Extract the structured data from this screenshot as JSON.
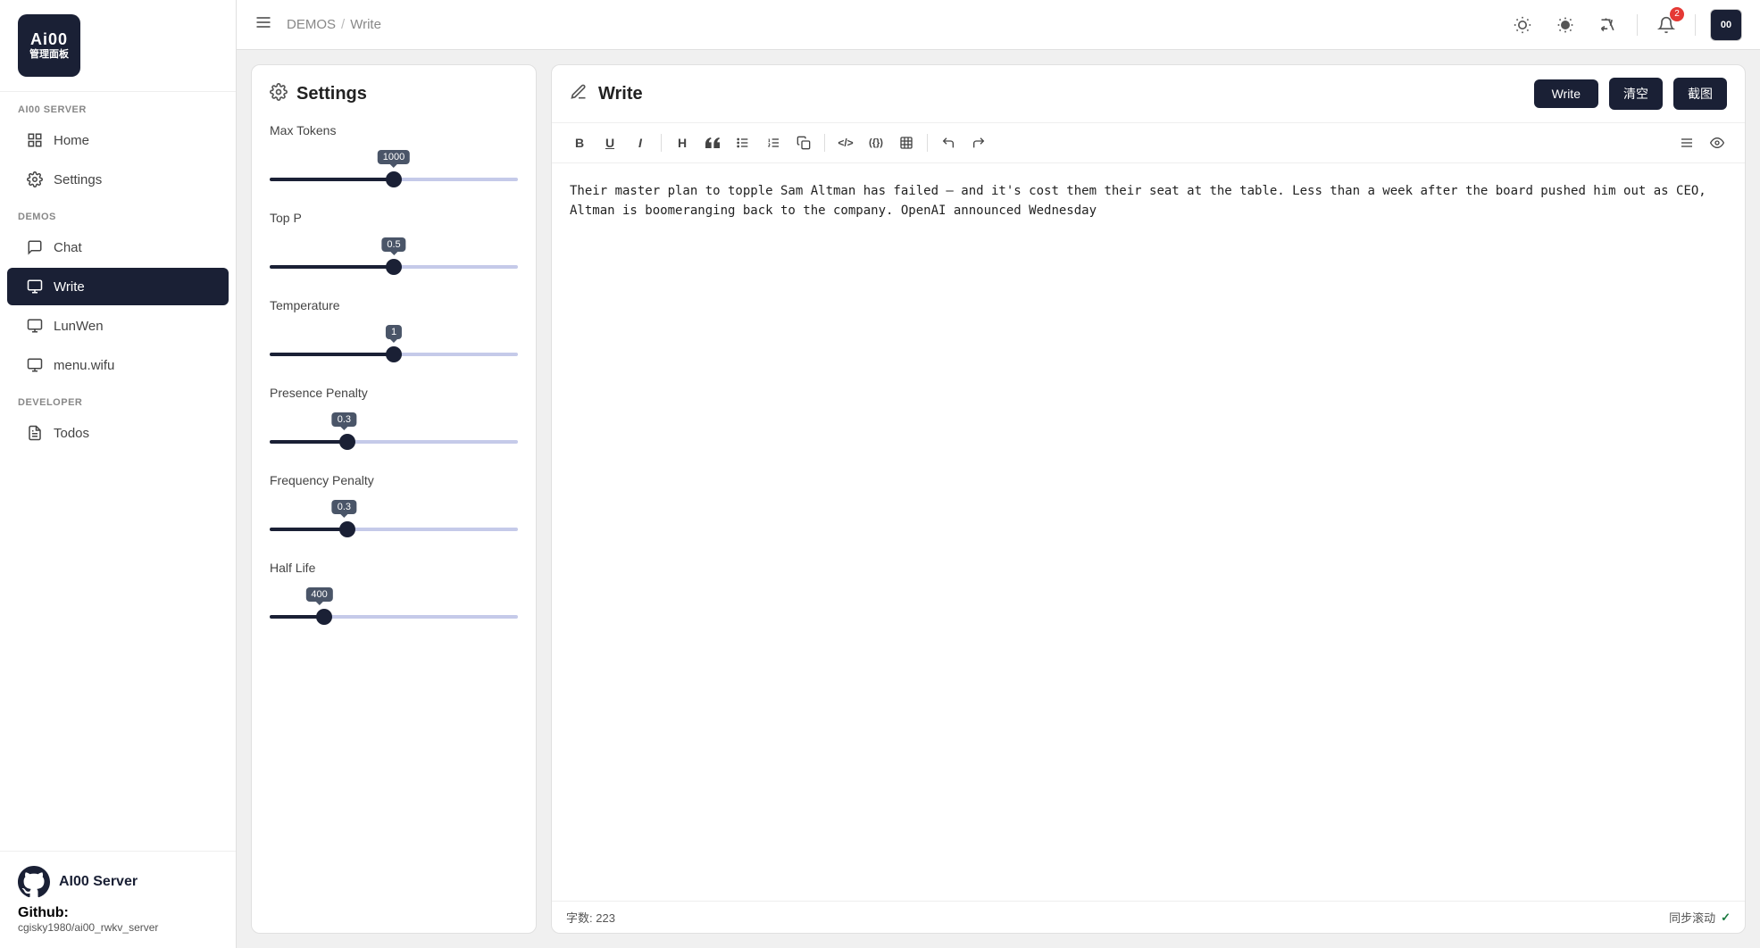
{
  "sidebar": {
    "logo_top": "Ai00",
    "logo_bottom": "管理面板",
    "section_server": "AI00 SERVER",
    "items_server": [
      {
        "label": "Home",
        "icon": "grid"
      },
      {
        "label": "Settings",
        "icon": "gear"
      }
    ],
    "section_demos": "DEMOS",
    "items_demos": [
      {
        "label": "Chat",
        "icon": "chat"
      },
      {
        "label": "Write",
        "icon": "write",
        "active": true
      },
      {
        "label": "LunWen",
        "icon": "lunwen"
      },
      {
        "label": "menu.wifu",
        "icon": "menu"
      }
    ],
    "section_developer": "DEVELOPER",
    "items_developer": [
      {
        "label": "Todos",
        "icon": "todos"
      }
    ],
    "footer_server": "AI00 Server",
    "github_label": "Github:",
    "github_link": "cgisky1980/ai00_rwkv_server"
  },
  "topbar": {
    "breadcrumb_root": "DEMOS",
    "breadcrumb_sep": "/",
    "breadcrumb_current": "Write",
    "notification_count": "2",
    "avatar_text": "00"
  },
  "settings": {
    "title": "Settings",
    "sliders": [
      {
        "label": "Max Tokens",
        "value": 1000,
        "min": 0,
        "max": 2000,
        "fill_pct": 50
      },
      {
        "label": "Top P",
        "value": 0.5,
        "min": 0,
        "max": 1,
        "fill_pct": 50
      },
      {
        "label": "Temperature",
        "value": 1.0,
        "min": 0,
        "max": 2,
        "fill_pct": 50
      },
      {
        "label": "Presence Penalty",
        "value": 0.3,
        "min": 0,
        "max": 1,
        "fill_pct": 30
      },
      {
        "label": "Frequency Penalty",
        "value": 0.3,
        "min": 0,
        "max": 1,
        "fill_pct": 30
      },
      {
        "label": "Half Life",
        "value": 400,
        "min": 0,
        "max": 2000,
        "fill_pct": 20
      }
    ]
  },
  "write": {
    "title": "Write",
    "btn_write": "Write",
    "btn_clear": "清空",
    "btn_screenshot": "截图",
    "toolbar": {
      "bold": "B",
      "underline": "U",
      "italic": "I",
      "heading": "H",
      "quote": "❝",
      "bullet": "≡",
      "numbered": "≡",
      "copy": "⧉",
      "code": "</>",
      "inline_code": "({})",
      "table": "⊞",
      "undo": "↩",
      "redo": "↪",
      "source": "≡",
      "preview": "◎"
    },
    "content": "Their master plan to topple Sam Altman has failed – and it's cost them their seat at the table.\nLess than a week after the board pushed him out as CEO, Altman is boomeranging back to the\ncompany. OpenAI announced Wednesday",
    "word_count_label": "字数:",
    "word_count": "223",
    "sync_label": "同步滚动",
    "sync_check": "✓"
  }
}
